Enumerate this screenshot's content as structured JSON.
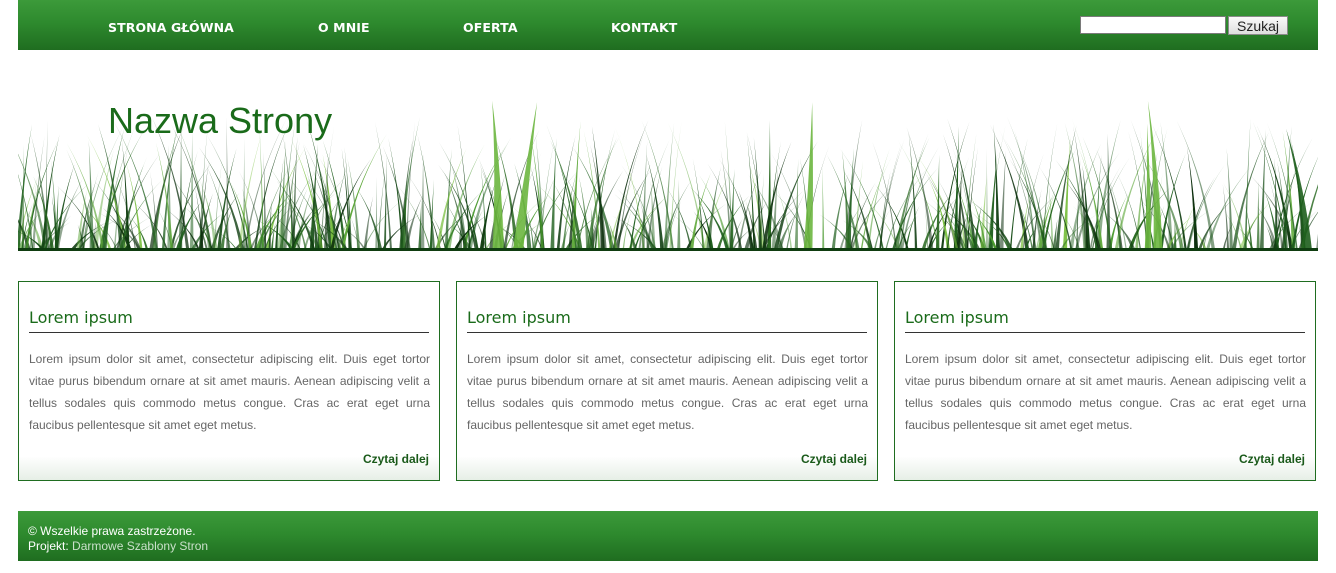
{
  "nav": {
    "items": [
      {
        "label": "STRONA GŁÓWNA"
      },
      {
        "label": "O MNIE"
      },
      {
        "label": "OFERTA"
      },
      {
        "label": "KONTAKT"
      }
    ]
  },
  "search": {
    "value": "",
    "button_label": "Szukaj"
  },
  "header": {
    "site_title": "Nazwa Strony"
  },
  "boxes": [
    {
      "title": "Lorem ipsum",
      "text": "Lorem ipsum dolor sit amet, consectetur adipiscing elit. Duis eget tortor vitae purus bibendum ornare at sit amet mauris. Aenean adipiscing velit a tellus sodales quis commodo metus congue. Cras ac erat eget urna faucibus pellentesque sit amet eget metus.",
      "more_label": "Czytaj dalej"
    },
    {
      "title": "Lorem ipsum",
      "text": "Lorem ipsum dolor sit amet, consectetur adipiscing elit. Duis eget tortor vitae purus bibendum ornare at sit amet mauris. Aenean adipiscing velit a tellus sodales quis commodo metus congue. Cras ac erat eget urna faucibus pellentesque sit amet eget metus.",
      "more_label": "Czytaj dalej"
    },
    {
      "title": "Lorem ipsum",
      "text": "Lorem ipsum dolor sit amet, consectetur adipiscing elit. Duis eget tortor vitae purus bibendum ornare at sit amet mauris. Aenean adipiscing velit a tellus sodales quis commodo metus congue. Cras ac erat eget urna faucibus pellentesque sit amet eget metus.",
      "more_label": "Czytaj dalej"
    }
  ],
  "footer": {
    "copyright": "© Wszelkie prawa zastrzeżone.",
    "design_prefix": "Projekt:",
    "design_link": "Darmowe Szablony Stron"
  },
  "colors": {
    "brand_green": "#2e8a2e",
    "brand_green_dark": "#1f6d20",
    "title_green": "#1a6b1a",
    "body_text": "#666666"
  },
  "icons": {
    "header_image": "grass-image"
  }
}
